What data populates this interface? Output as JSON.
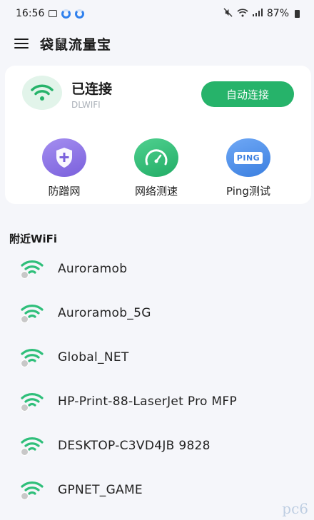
{
  "status_bar": {
    "time": "16:56",
    "battery": "87%"
  },
  "app": {
    "title": "袋鼠流量宝"
  },
  "connection": {
    "status": "已连接",
    "ssid": "DLWIFI",
    "auto_connect_label": "自动连接"
  },
  "tools": [
    {
      "label": "防蹭网",
      "icon": "shield-plus-icon"
    },
    {
      "label": "网络测速",
      "icon": "speedometer-icon"
    },
    {
      "label": "Ping测试",
      "icon": "ping-icon"
    }
  ],
  "nearby": {
    "title": "附近WiFi",
    "networks": [
      {
        "name": "Auroramob"
      },
      {
        "name": "Auroramob_5G"
      },
      {
        "name": "Global_NET"
      },
      {
        "name": "HP-Print-88-LaserJet Pro MFP"
      },
      {
        "name": "DESKTOP-C3VD4JB 9828"
      },
      {
        "name": "GPNET_GAME"
      }
    ]
  },
  "watermark": "pc6",
  "colors": {
    "accent": "#26b36a",
    "wifi_green": "#2fbf7a",
    "purple": "#7a60dc",
    "blue": "#3b7fe0"
  }
}
